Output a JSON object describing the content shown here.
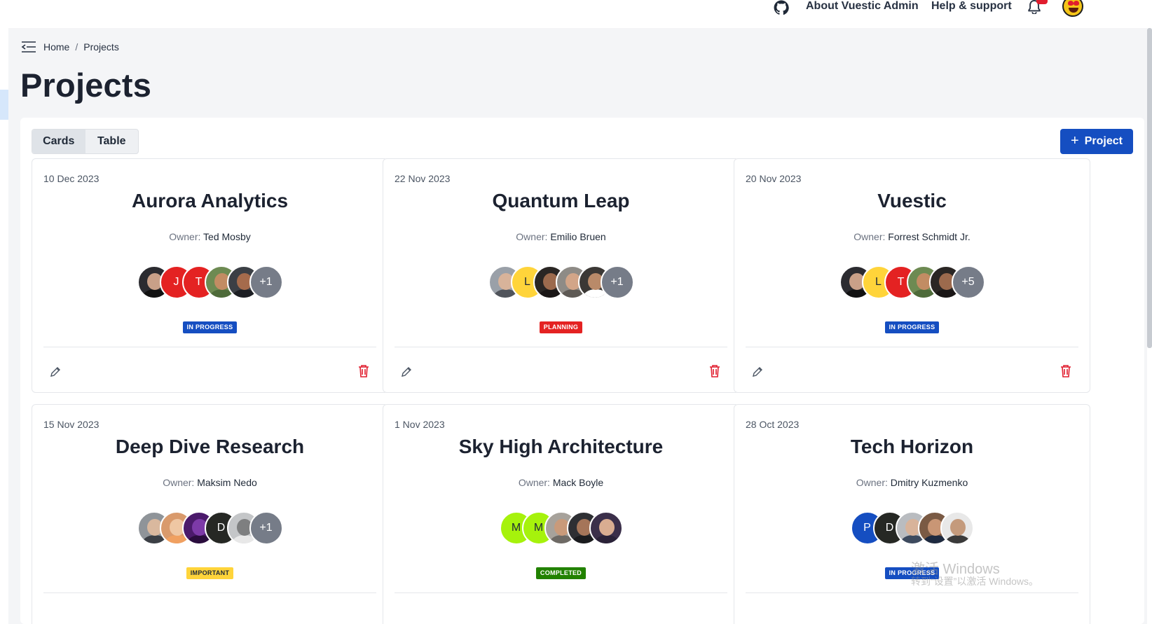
{
  "topbar": {
    "icons": [
      "github-icon",
      "bell-icon",
      "emoji-avatar"
    ],
    "about_label": "About Vuestic Admin",
    "help_label": "Help & support"
  },
  "breadcrumb": {
    "home": "Home",
    "separator": "/",
    "current": "Projects"
  },
  "page": {
    "title": "Projects"
  },
  "view_toggle": {
    "options": [
      "Cards",
      "Table"
    ],
    "selected": "Cards"
  },
  "add_button": {
    "icon": "+",
    "label": "Project"
  },
  "colors": {
    "primary": "#154ec1",
    "danger": "#e11d2e",
    "warning": "#ffd43a",
    "success": "#228200",
    "neutral_avatar": "#767c88"
  },
  "projects": [
    {
      "date": "10 Dec 2023",
      "title": "Aurora Analytics",
      "owner_label": "Owner:",
      "owner": "Ted Mosby",
      "status": "IN PROGRESS",
      "status_color": "#154ec1",
      "status_text_color": "#ffffff",
      "avatars": [
        {
          "type": "photo",
          "bg": "#2b2b30",
          "skin": "#c9a088",
          "shirt": "#121212"
        },
        {
          "type": "initial",
          "text": "J",
          "bg": "#e42222"
        },
        {
          "type": "initial",
          "text": "T",
          "bg": "#e42222"
        },
        {
          "type": "photo",
          "bg": "#6d8a52",
          "skin": "#c28c63",
          "shirt": "#4e6b3a"
        },
        {
          "type": "photo",
          "bg": "#3b3f45",
          "skin": "#a56b4c",
          "shirt": "#1d1f24"
        },
        {
          "type": "more",
          "text": "+1",
          "bg": "#767c88"
        }
      ]
    },
    {
      "date": "22 Nov 2023",
      "title": "Quantum Leap",
      "owner_label": "Owner:",
      "owner": "Emilio Bruen",
      "status": "PLANNING",
      "status_color": "#e42222",
      "status_text_color": "#ffffff",
      "avatars": [
        {
          "type": "photo",
          "bg": "#9aa0a8",
          "skin": "#d8b39a",
          "shirt": "#50545b"
        },
        {
          "type": "initial",
          "text": "L",
          "bg": "#ffd43a",
          "color": "#1f2937"
        },
        {
          "type": "photo",
          "bg": "#2a2624",
          "skin": "#9c6a4d",
          "shirt": "#1a1616"
        },
        {
          "type": "photo",
          "bg": "#8e8b86",
          "skin": "#d2a588",
          "shirt": "#5e5a55"
        },
        {
          "type": "photo",
          "bg": "#3b3835",
          "skin": "#b98a69",
          "shirt": "#ffffff"
        },
        {
          "type": "more",
          "text": "+1",
          "bg": "#767c88"
        }
      ]
    },
    {
      "date": "20 Nov 2023",
      "title": "Vuestic",
      "owner_label": "Owner:",
      "owner": "Forrest Schmidt Jr.",
      "status": "IN PROGRESS",
      "status_color": "#154ec1",
      "status_text_color": "#ffffff",
      "avatars": [
        {
          "type": "photo",
          "bg": "#2b2b30",
          "skin": "#c9a088",
          "shirt": "#121212"
        },
        {
          "type": "initial",
          "text": "L",
          "bg": "#ffd43a",
          "color": "#1f2937"
        },
        {
          "type": "initial",
          "text": "T",
          "bg": "#e42222"
        },
        {
          "type": "photo",
          "bg": "#6d8a52",
          "skin": "#c28c63",
          "shirt": "#4e6b3a"
        },
        {
          "type": "photo",
          "bg": "#2a2624",
          "skin": "#9c6a4d",
          "shirt": "#1a1616"
        },
        {
          "type": "more",
          "text": "+5",
          "bg": "#767c88"
        }
      ]
    },
    {
      "date": "15 Nov 2023",
      "title": "Deep Dive Research",
      "owner_label": "Owner:",
      "owner": "Maksim Nedo",
      "status": "IMPORTANT",
      "status_color": "#ffd43a",
      "status_text_color": "#1f2937",
      "avatars": [
        {
          "type": "photo",
          "bg": "#8f9499",
          "skin": "#d9b89e",
          "shirt": "#3b3f45"
        },
        {
          "type": "photo",
          "bg": "#d99a6c",
          "skin": "#efc7a3",
          "shirt": "#f0a060"
        },
        {
          "type": "photo",
          "bg": "#4b1a6b",
          "skin": "#7d3aa8",
          "shirt": "#2a0d3d"
        },
        {
          "type": "initial",
          "text": "D",
          "bg": "#262824"
        },
        {
          "type": "photo",
          "bg": "#c4c6c8",
          "skin": "#7e7f80",
          "shirt": "#e8e8e8"
        },
        {
          "type": "more",
          "text": "+1",
          "bg": "#767c88"
        }
      ]
    },
    {
      "date": "1 Nov 2023",
      "title": "Sky High Architecture",
      "owner_label": "Owner:",
      "owner": "Mack Boyle",
      "status": "COMPLETED",
      "status_color": "#228200",
      "status_text_color": "#ffffff",
      "avatars": [
        {
          "type": "initial",
          "text": "M",
          "bg": "#a6f20c",
          "color": "#1f2937"
        },
        {
          "type": "initial",
          "text": "M",
          "bg": "#a6f20c",
          "color": "#1f2937"
        },
        {
          "type": "photo",
          "bg": "#a7a29b",
          "skin": "#c99a7a",
          "shirt": "#6e6a65"
        },
        {
          "type": "photo",
          "bg": "#2e2f33",
          "skin": "#a57559",
          "shirt": "#1a1b1e"
        },
        {
          "type": "photo",
          "bg": "#3b2f4a",
          "skin": "#d9ad91",
          "shirt": "#2a2238"
        }
      ]
    },
    {
      "date": "28 Oct 2023",
      "title": "Tech Horizon",
      "owner_label": "Owner:",
      "owner": "Dmitry Kuzmenko",
      "status": "IN PROGRESS",
      "status_color": "#154ec1",
      "status_text_color": "#ffffff",
      "avatars": [
        {
          "type": "initial",
          "text": "P",
          "bg": "#154ec1"
        },
        {
          "type": "initial",
          "text": "D",
          "bg": "#262824"
        },
        {
          "type": "photo",
          "bg": "#b9bcc0",
          "skin": "#d8b39a",
          "shirt": "#3d4a5e"
        },
        {
          "type": "photo",
          "bg": "#7a5a44",
          "skin": "#c99675",
          "shirt": "#1e2a40"
        },
        {
          "type": "photo",
          "bg": "#e8e8e8",
          "skin": "#c49a7c",
          "shirt": "#3a3a3a"
        }
      ]
    }
  ],
  "watermark": {
    "line1": "激活 Windows",
    "line2": "转到“设置”以激活 Windows。"
  }
}
